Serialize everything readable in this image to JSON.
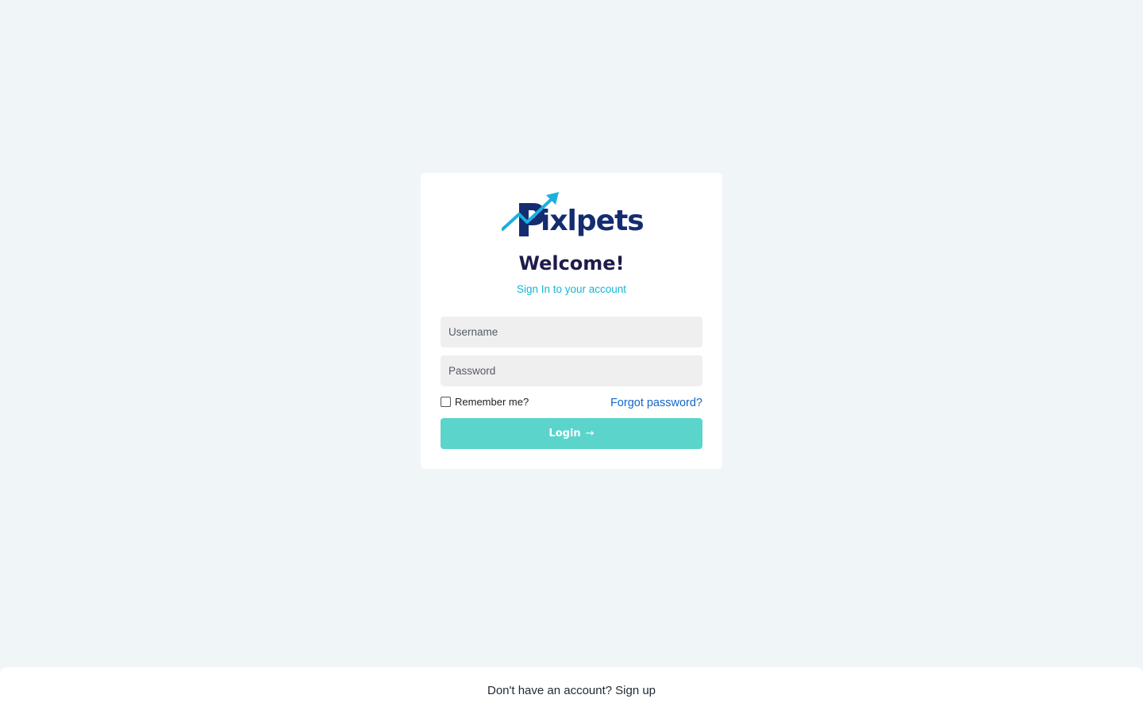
{
  "brand": {
    "name": "ixlpets",
    "logo_icon": "arrow-chart-p-icon",
    "primary_color": "#142c70",
    "accent_color": "#1bb0e0"
  },
  "login_card": {
    "title": "Welcome!",
    "subtitle": "Sign In to your account",
    "username_placeholder": "Username",
    "password_placeholder": "Password",
    "remember_label": "Remember me?",
    "forgot_label": "Forgot password?",
    "login_label": "Login",
    "login_icon": "arrow-right-icon",
    "button_color": "#5bd4cb"
  },
  "footer": {
    "prompt": "Don't have an account?",
    "signup_label": "Sign up"
  }
}
